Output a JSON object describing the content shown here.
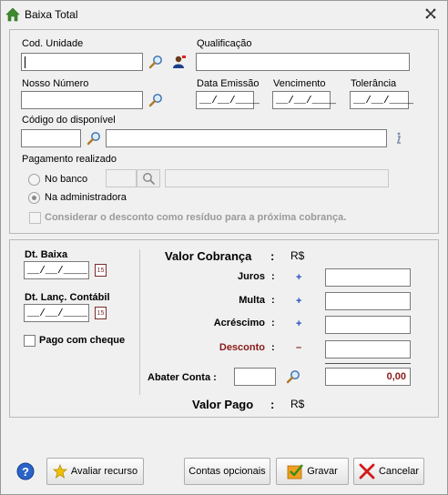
{
  "window": {
    "title": "Baixa Total"
  },
  "unit": {
    "cod_unidade_label": "Cod. Unidade",
    "qualificacao_label": "Qualificação",
    "nosso_numero_label": "Nosso Número",
    "data_emissao_label": "Data Emissão",
    "vencimento_label": "Vencimento",
    "tolerancia_label": "Tolerância",
    "codigo_disponivel_label": "Código do disponível",
    "date_mask": "__/__/____"
  },
  "payment": {
    "label": "Pagamento realizado",
    "option_banco": "No banco",
    "option_admin": "Na administradora",
    "considerar_desconto": "Considerar o desconto como resíduo para a próxima cobrança."
  },
  "baixa": {
    "dt_baixa_label": "Dt. Baixa",
    "dt_lanc_label": "Dt. Lanç. Contábil",
    "date_mask": "__/__/____",
    "pago_cheque": "Pago com cheque",
    "calendar_day": "15"
  },
  "values": {
    "valor_cobranca_label": "Valor Cobrança",
    "colon": ":",
    "currency": "R$",
    "juros_label": "Juros",
    "multa_label": "Multa",
    "acrescimo_label": "Acréscimo",
    "desconto_label": "Desconto",
    "plus": "+",
    "minus": "–",
    "abater_conta_label": "Abater Conta :",
    "abater_value": "0,00",
    "valor_pago_label": "Valor Pago",
    "colors": {
      "desconto": "#8b1a1a",
      "value_red": "#8b1a1a",
      "plus_blue": "#1f4fbf"
    }
  },
  "buttons": {
    "avaliar_recurso": "Avaliar recurso",
    "contas_opcionais": "Contas opcionais",
    "gravar": "Gravar",
    "cancelar": "Cancelar"
  }
}
